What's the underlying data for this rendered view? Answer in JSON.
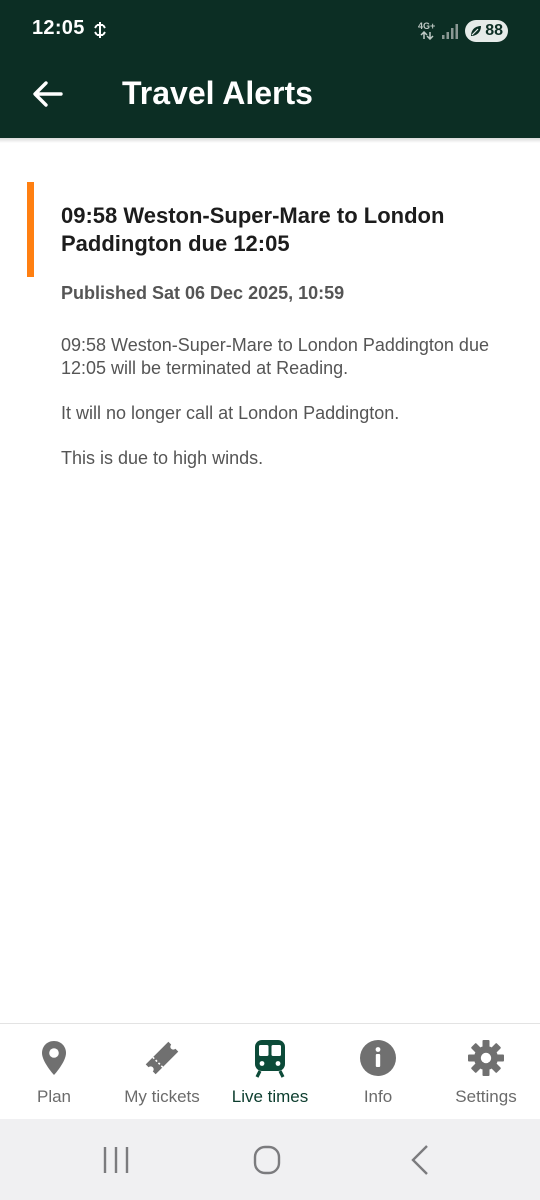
{
  "status_bar": {
    "time": "12:05",
    "network": "4G+",
    "battery_level": "88"
  },
  "header": {
    "title": "Travel Alerts",
    "back_icon": "arrow-left-icon"
  },
  "alert": {
    "accent_color": "#ff7f11",
    "title": "09:58 Weston-Super-Mare to London Paddington due 12:05",
    "published": "Published Sat 06 Dec 2025, 10:59",
    "paragraphs": [
      "09:58 Weston-Super-Mare to London Paddington due 12:05 will be terminated at Reading.",
      "It will no longer call at London Paddington.",
      "This is due to high winds."
    ]
  },
  "bottom_nav": {
    "items": [
      {
        "label": "Plan",
        "icon": "map-pin-icon",
        "active": false
      },
      {
        "label": "My tickets",
        "icon": "ticket-icon",
        "active": false
      },
      {
        "label": "Live times",
        "icon": "train-icon",
        "active": true
      },
      {
        "label": "Info",
        "icon": "info-icon",
        "active": false
      },
      {
        "label": "Settings",
        "icon": "gear-icon",
        "active": false
      }
    ]
  },
  "system_nav": {
    "buttons": [
      "recent-apps-icon",
      "home-icon",
      "back-icon"
    ]
  },
  "colors": {
    "brand_dark": "#0c2e24",
    "accent": "#ff7f11",
    "nav_inactive": "#6b6b6b",
    "nav_active": "#0c3d2e"
  }
}
